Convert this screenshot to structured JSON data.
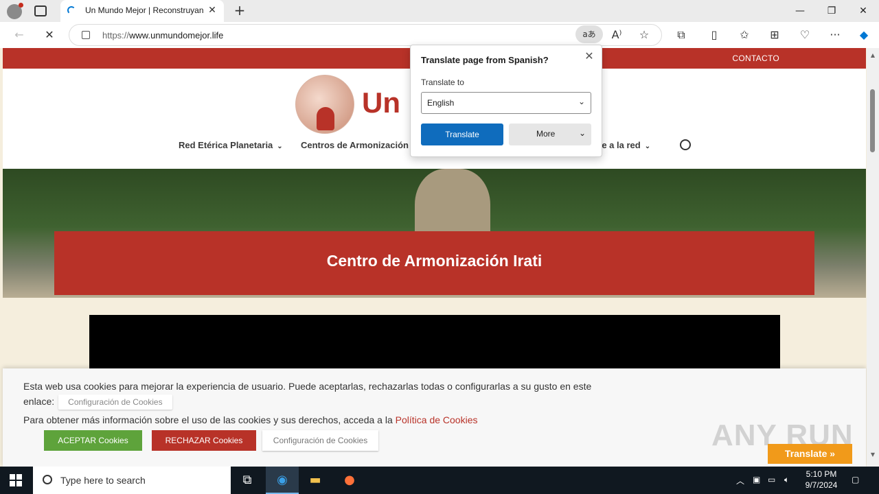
{
  "browser": {
    "tab_title": "Un Mundo Mejor | Reconstruyan",
    "url_prefix": "https://",
    "url_main": "www.unmundomejor.life",
    "translate_icon": "aあ"
  },
  "site": {
    "contact": "CONTACTO",
    "brand": "Un",
    "menu": [
      {
        "label": "Red Etérica Planetaria"
      },
      {
        "label": "Centros de Armonización"
      },
      {
        "label": "te a la red"
      }
    ],
    "hero_title": "Centro de Armonización Irati"
  },
  "cookie": {
    "line1": "Esta web usa cookies para mejorar la experiencia de usuario. Puede aceptarlas, rechazarlas todas o configurarlas a su gusto en este",
    "line2_prefix": "enlace:",
    "config_link": "Configuración de Cookies",
    "line3_prefix": "Para obtener más información sobre el uso de las cookies y sus derechos, acceda a la",
    "policy_link": "Política de Cookies",
    "accept": "ACEPTAR Cookies",
    "reject": "RECHAZAR Cookies",
    "configure": "Configuración de Cookies"
  },
  "overlay": {
    "watermark": "ANY RUN",
    "translate_button": "Translate »"
  },
  "translate_popup": {
    "title": "Translate page from Spanish?",
    "label": "Translate to",
    "selected": "English",
    "translate_btn": "Translate",
    "more_btn": "More"
  },
  "taskbar": {
    "search_placeholder": "Type here to search",
    "time": "5:10 PM",
    "date": "9/7/2024"
  },
  "colors": {
    "brand_red": "#b83228",
    "accept_green": "#5ea33b",
    "translate_blue": "#0f6cbd",
    "orange": "#f19a1a"
  }
}
